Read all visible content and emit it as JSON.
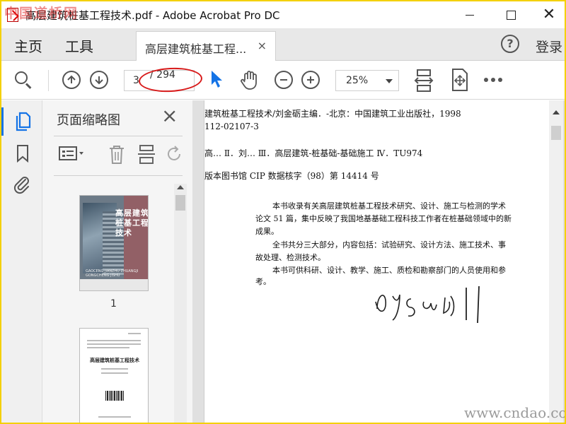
{
  "window": {
    "title": "高层建筑桩基工程技术.pdf - Adobe Acrobat Pro DC"
  },
  "nav": {
    "home": "主页",
    "tools": "工具",
    "tab_label": "高层建筑桩基工程...",
    "tab_close": "×",
    "help": "?",
    "login": "登录"
  },
  "toolbar": {
    "page_current": "3",
    "page_total": "/ 294",
    "zoom": "25%"
  },
  "thumbnails": {
    "panel_title": "页面缩略图",
    "page1_label": "1",
    "cover_title": "高层建筑桩基工程技术",
    "cover_subtitle": "GAOCENG JIANZHU ZHUANGJI GONGCHENG JISHU",
    "page2_title": "高层建筑桩基工程技术"
  },
  "document": {
    "lines": [
      "建筑桩基工程技术/刘金砺主编．-北京：中国建筑工业出版社，1998",
      "112-02107-3",
      "高…  Ⅱ．刘…  Ⅲ．高层建筑-桩基础-基础施工  Ⅳ．TU974",
      "版本图书馆 CIP 数据核字（98）第 14414 号"
    ],
    "paragraphs": [
      "本书收录有关高层建筑桩基工程技术研究、设计、施工与检测的学术",
      "论文 51 篇，集中反映了我国地基基础工程科技工作者在桩基础领域中的新",
      "成果。",
      "全书共分三大部分，内容包括：试验研究、设计方法、施工技术、事",
      "故处理、检测技术。",
      "本书可供科研、设计、教学、施工、质检和勘察部门的人员使用和参",
      "考。"
    ]
  },
  "watermarks": {
    "top_left": "中国道桥网",
    "bottom_right": "www.cndao.com"
  },
  "colors": {
    "accent": "#1473e6",
    "annotation_red": "#d81b1b",
    "frame_border": "#f4d000"
  }
}
